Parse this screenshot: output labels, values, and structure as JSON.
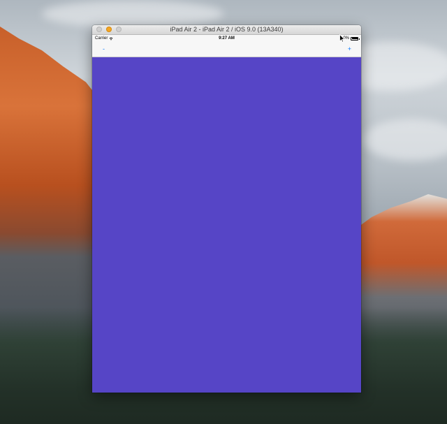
{
  "window": {
    "title": "iPad Air 2 - iPad Air 2 / iOS 9.0 (13A340)"
  },
  "status_bar": {
    "carrier": "Carrier",
    "time": "9:27 AM",
    "battery_text": "0%"
  },
  "nav_bar": {
    "left_button": "-",
    "right_button": "+"
  },
  "colors": {
    "content_background": "#5645c6",
    "tint": "#0a7aff"
  },
  "icons": {
    "wifi": "wifi-icon",
    "battery": "battery-icon",
    "cursor": "cursor-icon"
  }
}
